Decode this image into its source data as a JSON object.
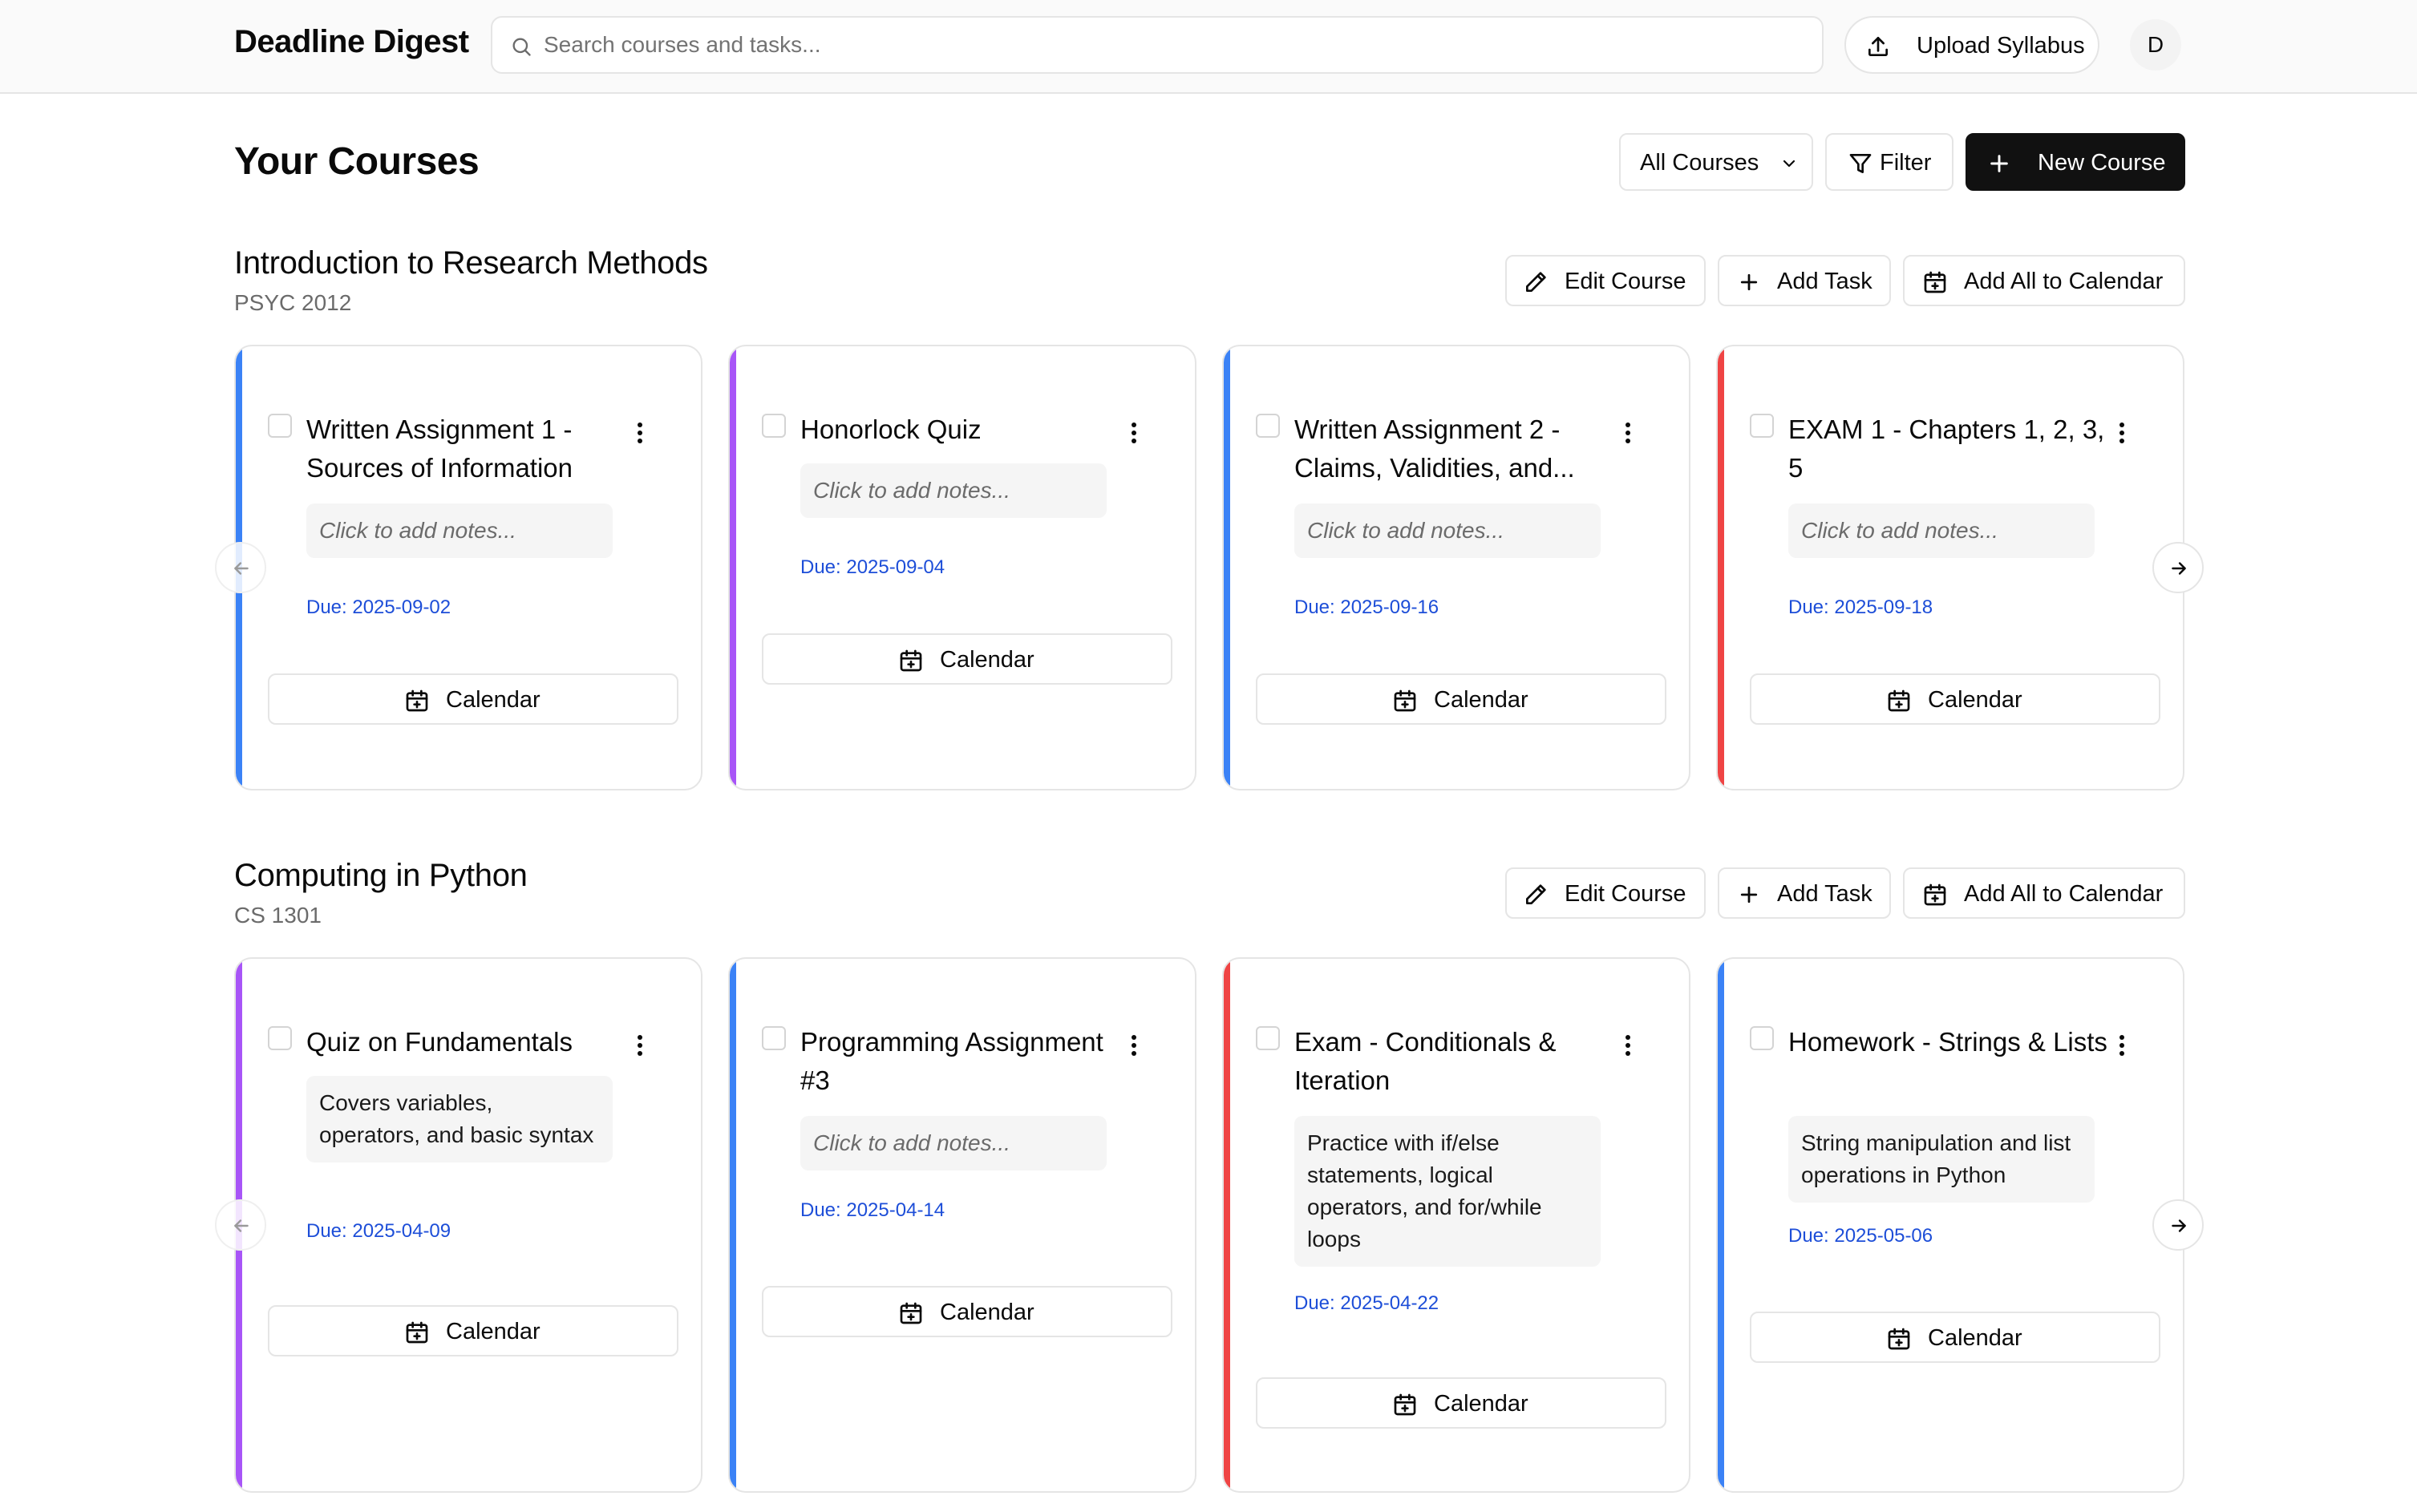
{
  "header": {
    "brand": "Deadline Digest",
    "search_placeholder": "Search courses and tasks...",
    "upload_label": "Upload Syllabus",
    "avatar_initial": "D"
  },
  "page": {
    "title": "Your Courses",
    "course_filter_selected": "All Courses",
    "filter_label": "Filter",
    "new_course_label": "New Course"
  },
  "section_actions": {
    "edit_course": "Edit Course",
    "add_task": "Add Task",
    "add_all_to_calendar": "Add All to Calendar"
  },
  "accent_colors": {
    "blue": "#3b82f6",
    "purple": "#a855f7",
    "red": "#ef4444",
    "due_text": "#1d4ed8"
  },
  "courses": [
    {
      "title": "Introduction to Research Methods",
      "code": "PSYC 2012",
      "tasks": [
        {
          "title": "Written Assignment 1 - Sources of Information",
          "notes": "Click to add notes...",
          "notes_placeholder": true,
          "due": "Due: 2025-09-02",
          "color": "blue",
          "calendar_label": "Calendar"
        },
        {
          "title": "Honorlock Quiz",
          "notes": "Click to add notes...",
          "notes_placeholder": true,
          "due": "Due: 2025-09-04",
          "color": "purple",
          "calendar_label": "Calendar"
        },
        {
          "title": "Written Assignment 2 - Claims, Validities, and...",
          "notes": "Click to add notes...",
          "notes_placeholder": true,
          "due": "Due: 2025-09-16",
          "color": "blue",
          "calendar_label": "Calendar"
        },
        {
          "title": "EXAM 1 - Chapters 1, 2, 3, 5",
          "notes": "Click to add notes...",
          "notes_placeholder": true,
          "due": "Due: 2025-09-18",
          "color": "red",
          "calendar_label": "Calendar"
        }
      ]
    },
    {
      "title": "Computing in Python",
      "code": "CS 1301",
      "tasks": [
        {
          "title": "Quiz on Fundamentals",
          "notes": "Covers variables, operators, and basic syntax",
          "notes_placeholder": false,
          "due": "Due: 2025-04-09",
          "color": "purple",
          "calendar_label": "Calendar"
        },
        {
          "title": "Programming Assignment #3",
          "notes": "Click to add notes...",
          "notes_placeholder": true,
          "due": "Due: 2025-04-14",
          "color": "blue",
          "calendar_label": "Calendar"
        },
        {
          "title": "Exam - Conditionals & Iteration",
          "notes": "Practice with if/else statements, logical operators, and for/while loops",
          "notes_placeholder": false,
          "due": "Due: 2025-04-22",
          "color": "red",
          "calendar_label": "Calendar"
        },
        {
          "title": "Homework - Strings & Lists",
          "notes": "String manipulation and list operations in Python",
          "notes_placeholder": false,
          "due": "Due: 2025-05-06",
          "color": "blue",
          "calendar_label": "Calendar"
        }
      ]
    }
  ],
  "icons": {
    "search": "search-icon",
    "upload": "upload-icon",
    "chevron": "chevron-down-icon",
    "filter": "filter-icon",
    "plus": "plus-icon",
    "edit": "pencil-icon",
    "calendar": "calendar-plus-icon",
    "menu": "more-vertical-icon",
    "prev": "arrow-left-icon",
    "next": "arrow-right-icon"
  }
}
